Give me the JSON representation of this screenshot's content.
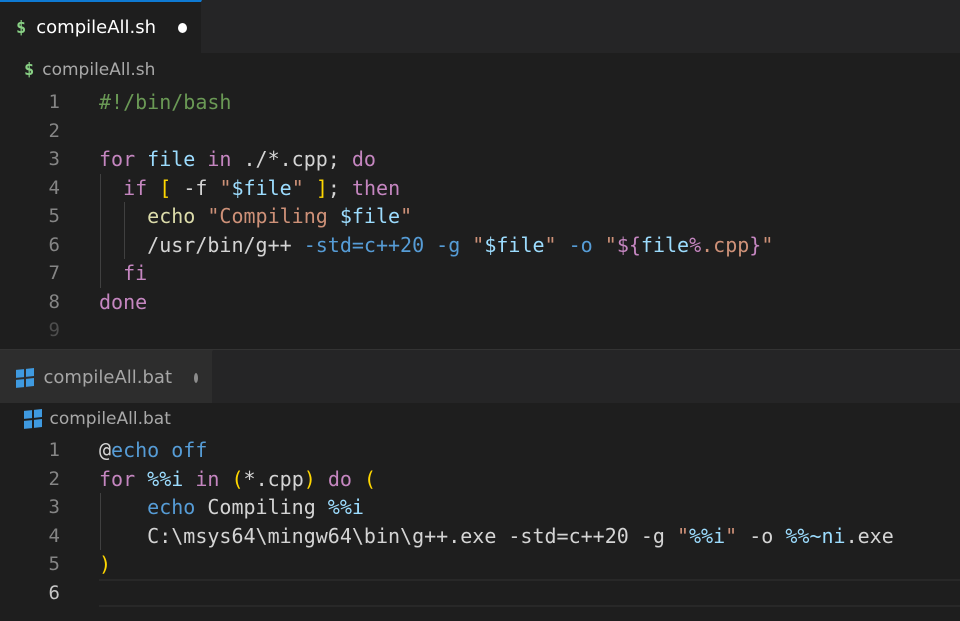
{
  "editors": [
    {
      "tab": {
        "label": "compileAll.sh",
        "icon": "dollar-sign-icon",
        "dirty": true,
        "active": true
      },
      "breadcrumb": {
        "label": "compileAll.sh",
        "icon": "dollar-sign-icon"
      },
      "language": "shellscript",
      "icon_glyph": "$",
      "line_numbers": [
        "1",
        "2",
        "3",
        "4",
        "5",
        "6",
        "7",
        "8",
        "9"
      ],
      "lines": [
        [
          {
            "text": "#!/bin/bash",
            "cls": "c"
          }
        ],
        [],
        [
          {
            "text": "for",
            "cls": "k"
          },
          {
            "text": " file ",
            "cls": "v"
          },
          {
            "text": "in",
            "cls": "k"
          },
          {
            "text": " ./*.cpp; ",
            "cls": "t"
          },
          {
            "text": "do",
            "cls": "k"
          }
        ],
        [
          {
            "text": "  ",
            "cls": "t"
          },
          {
            "text": "if",
            "cls": "k"
          },
          {
            "text": " ",
            "cls": "t"
          },
          {
            "text": "[",
            "cls": "y"
          },
          {
            "text": " -f ",
            "cls": "t"
          },
          {
            "text": "\"",
            "cls": "s"
          },
          {
            "text": "$file",
            "cls": "v"
          },
          {
            "text": "\"",
            "cls": "s"
          },
          {
            "text": " ",
            "cls": "t"
          },
          {
            "text": "]",
            "cls": "y"
          },
          {
            "text": "; ",
            "cls": "t"
          },
          {
            "text": "then",
            "cls": "k"
          }
        ],
        [
          {
            "text": "    ",
            "cls": "t"
          },
          {
            "text": "echo",
            "cls": "cmd"
          },
          {
            "text": " ",
            "cls": "t"
          },
          {
            "text": "\"Compiling ",
            "cls": "s"
          },
          {
            "text": "$file",
            "cls": "v"
          },
          {
            "text": "\"",
            "cls": "s"
          }
        ],
        [
          {
            "text": "    /usr/bin/g++ ",
            "cls": "t"
          },
          {
            "text": "-std=c++20 -g ",
            "cls": "b"
          },
          {
            "text": "\"",
            "cls": "s"
          },
          {
            "text": "$file",
            "cls": "v"
          },
          {
            "text": "\"",
            "cls": "s"
          },
          {
            "text": " ",
            "cls": "t"
          },
          {
            "text": "-o ",
            "cls": "b"
          },
          {
            "text": "\"",
            "cls": "s"
          },
          {
            "text": "${",
            "cls": "k"
          },
          {
            "text": "file",
            "cls": "v"
          },
          {
            "text": "%",
            "cls": "k"
          },
          {
            "text": ".cpp",
            "cls": "s"
          },
          {
            "text": "}",
            "cls": "k"
          },
          {
            "text": "\"",
            "cls": "s"
          }
        ],
        [
          {
            "text": "  ",
            "cls": "t"
          },
          {
            "text": "fi",
            "cls": "k"
          }
        ],
        [
          {
            "text": "done",
            "cls": "k"
          }
        ],
        []
      ]
    },
    {
      "tab": {
        "label": "compileAll.bat",
        "icon": "windows-icon",
        "dirty": true,
        "active": false
      },
      "breadcrumb": {
        "label": "compileAll.bat",
        "icon": "windows-icon"
      },
      "language": "bat",
      "line_numbers": [
        "1",
        "2",
        "3",
        "4",
        "5",
        "6"
      ],
      "lines": [
        [
          {
            "text": "@",
            "cls": "t"
          },
          {
            "text": "echo off",
            "cls": "b"
          }
        ],
        [
          {
            "text": "for",
            "cls": "k"
          },
          {
            "text": " ",
            "cls": "t"
          },
          {
            "text": "%%i",
            "cls": "v"
          },
          {
            "text": " ",
            "cls": "t"
          },
          {
            "text": "in",
            "cls": "k"
          },
          {
            "text": " ",
            "cls": "t"
          },
          {
            "text": "(",
            "cls": "y"
          },
          {
            "text": "*.cpp",
            "cls": "t"
          },
          {
            "text": ")",
            "cls": "y"
          },
          {
            "text": " ",
            "cls": "t"
          },
          {
            "text": "do",
            "cls": "k"
          },
          {
            "text": " ",
            "cls": "t"
          },
          {
            "text": "(",
            "cls": "y"
          }
        ],
        [
          {
            "text": "    ",
            "cls": "t"
          },
          {
            "text": "echo",
            "cls": "b"
          },
          {
            "text": " Compiling ",
            "cls": "t"
          },
          {
            "text": "%%i",
            "cls": "v"
          }
        ],
        [
          {
            "text": "    C:\\msys64\\mingw64\\bin\\g++.exe -std=c++20 -g ",
            "cls": "t"
          },
          {
            "text": "\"",
            "cls": "s"
          },
          {
            "text": "%%i",
            "cls": "v"
          },
          {
            "text": "\"",
            "cls": "s"
          },
          {
            "text": " -o ",
            "cls": "t"
          },
          {
            "text": "%%~ni",
            "cls": "v"
          },
          {
            "text": ".exe",
            "cls": "t"
          }
        ],
        [
          {
            "text": ")",
            "cls": "y"
          }
        ],
        []
      ]
    }
  ]
}
